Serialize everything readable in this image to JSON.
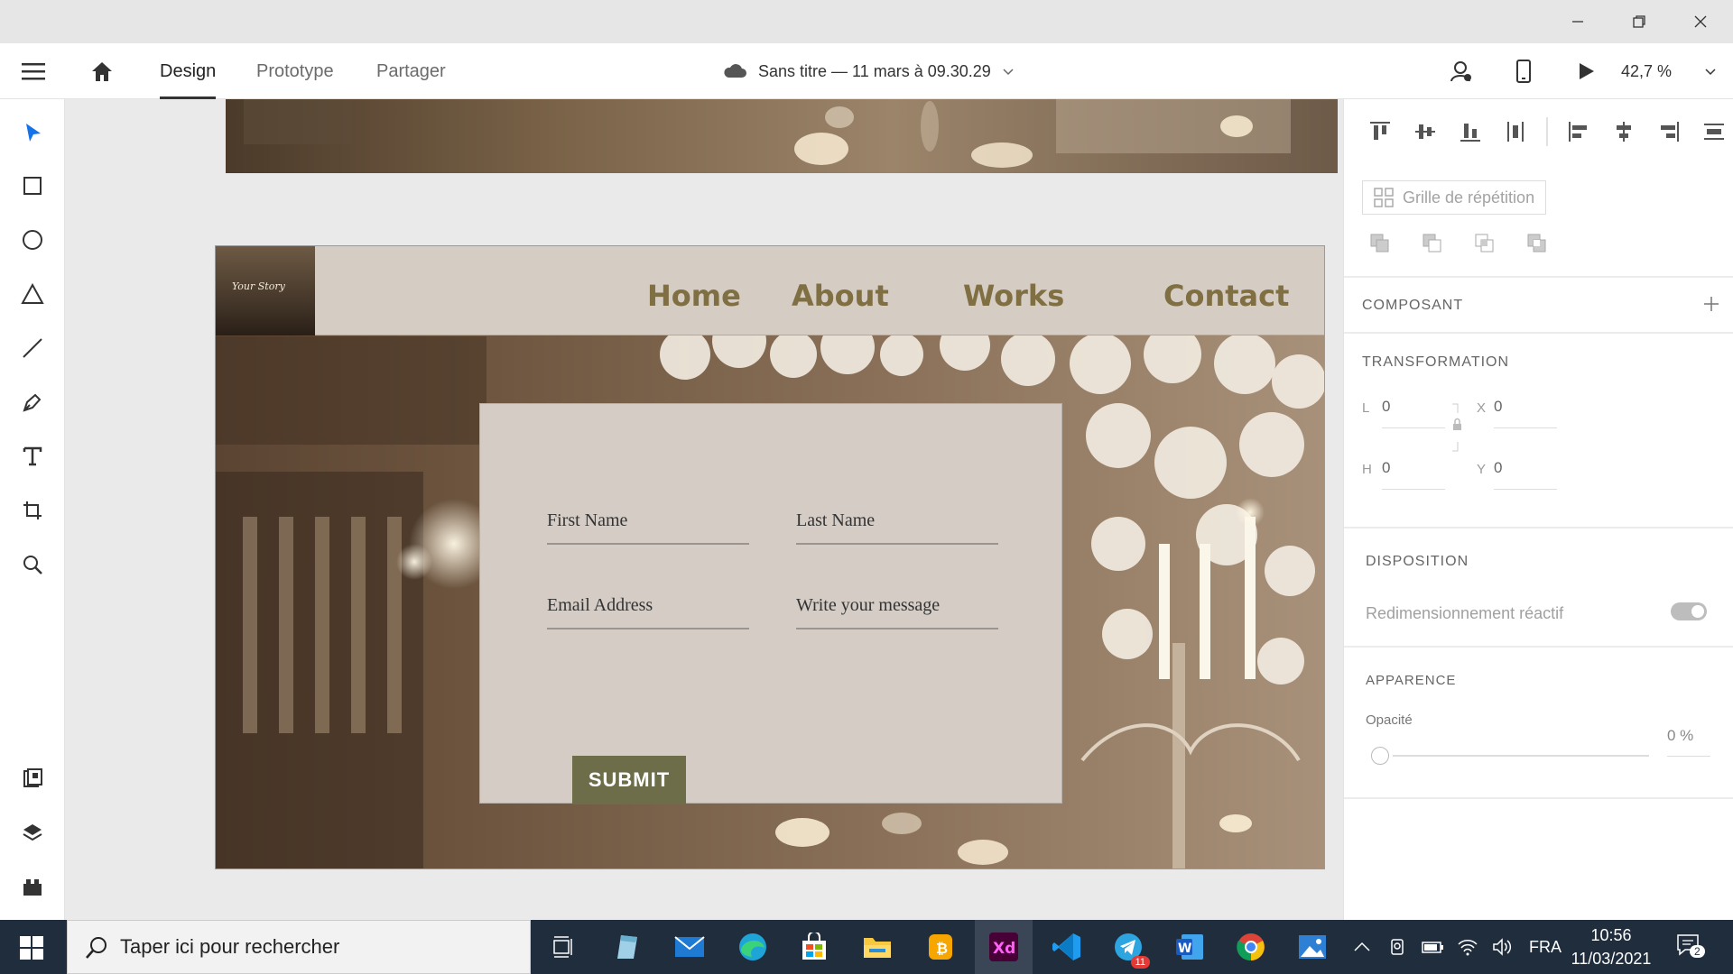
{
  "window": {
    "controls": [
      "minimize",
      "maximize",
      "close"
    ]
  },
  "appbar": {
    "tabs": [
      {
        "label": "Design",
        "active": true
      },
      {
        "label": "Prototype",
        "active": false
      },
      {
        "label": "Partager",
        "active": false
      }
    ],
    "document_title": "Sans titre — 11 mars à 09.30.29",
    "zoom": "42,7 %"
  },
  "toolbar": {
    "tools": [
      "select-tool",
      "rectangle-tool",
      "ellipse-tool",
      "polygon-tool",
      "line-tool",
      "pen-tool",
      "text-tool",
      "artboard-tool",
      "zoom-tool"
    ],
    "bottom_tools": [
      "assets-panel",
      "layers-panel",
      "plugins-panel"
    ]
  },
  "artboard": {
    "logo_text": "Your Story",
    "nav": [
      "Home",
      "About",
      "Works",
      "Contact"
    ],
    "form": {
      "first_name": "First Name",
      "last_name": "Last Name",
      "email": "Email Address",
      "message": "Write your message",
      "submit": "SUBMIT"
    },
    "colors": {
      "nav_bg": "#d5cdc4",
      "nav_text": "#7f6f42",
      "form_bg": "#d4ccc5",
      "submit_bg": "#6d6d4a"
    }
  },
  "panel": {
    "repeat_grid": "Grille de répétition",
    "component": "COMPOSANT",
    "transform": "TRANSFORMATION",
    "transform_fields": {
      "L": "0",
      "X": "0",
      "H": "0",
      "Y": "0"
    },
    "layout": "DISPOSITION",
    "responsive": "Redimensionnement réactif",
    "appearance": "APPARENCE",
    "opacity_label": "Opacité",
    "opacity_value": "0 %"
  },
  "taskbar": {
    "search_placeholder": "Taper ici pour rechercher",
    "language": "FRA",
    "time": "10:56",
    "date": "11/03/2021",
    "telegram_badge": "11",
    "notification_badge": "2"
  }
}
